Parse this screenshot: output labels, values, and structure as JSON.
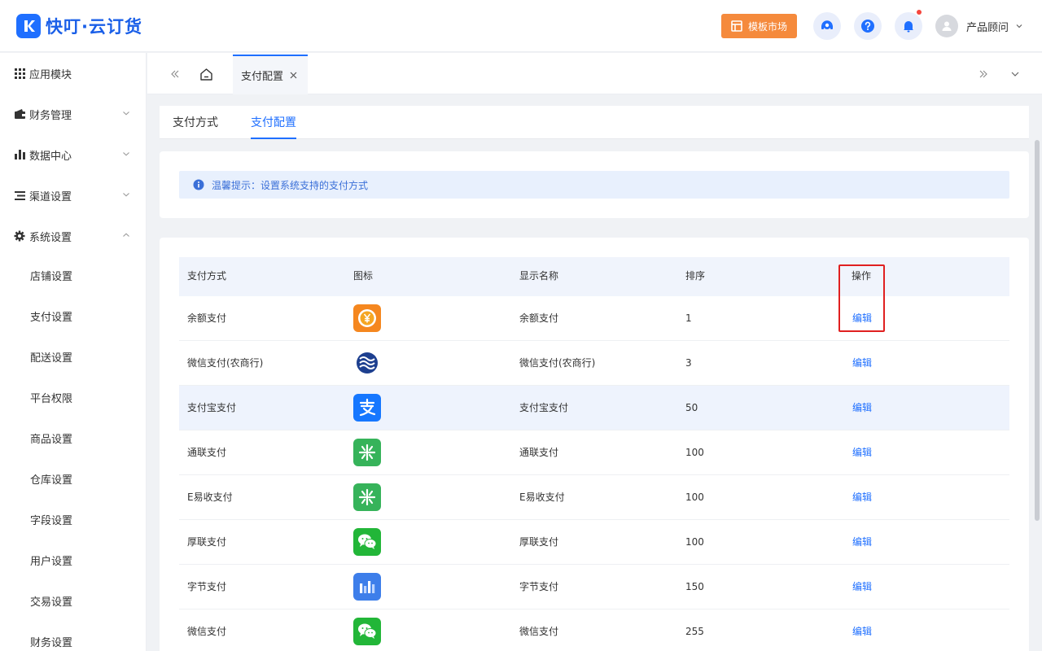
{
  "header": {
    "logo_text": "快叮·云订货",
    "template_market": "模板市场",
    "user_name": "产品顾问"
  },
  "sidebar": {
    "groups": [
      {
        "label": "应用模块",
        "icon": "grid-icon",
        "expanded": null
      },
      {
        "label": "财务管理",
        "icon": "wallet-icon",
        "expanded": false
      },
      {
        "label": "数据中心",
        "icon": "bar-chart-icon",
        "expanded": false
      },
      {
        "label": "渠道设置",
        "icon": "list-icon",
        "expanded": false
      },
      {
        "label": "系统设置",
        "icon": "gear-icon",
        "expanded": true
      }
    ],
    "sub_items": [
      "店铺设置",
      "支付设置",
      "配送设置",
      "平台权限",
      "商品设置",
      "仓库设置",
      "字段设置",
      "用户设置",
      "交易设置",
      "财务设置"
    ]
  },
  "tabbar": {
    "active_tab": "支付配置"
  },
  "subtabs": [
    "支付方式",
    "支付配置"
  ],
  "tip": {
    "text": "温馨提示：设置系统支持的支付方式"
  },
  "table": {
    "headers": [
      "支付方式",
      "图标",
      "显示名称",
      "排序",
      "操作"
    ],
    "rows": [
      {
        "method": "余额支付",
        "icon": "balance-yuan-icon",
        "display_name": "余额支付",
        "sort": "1",
        "action": "编辑"
      },
      {
        "method": "微信支付(农商行)",
        "icon": "rural-bank-wave-icon",
        "display_name": "微信支付(农商行)",
        "sort": "3",
        "action": "编辑"
      },
      {
        "method": "支付宝支付",
        "icon": "alipay-icon",
        "display_name": "支付宝支付",
        "sort": "50",
        "action": "编辑"
      },
      {
        "method": "通联支付",
        "icon": "allinpay-icon",
        "display_name": "通联支付",
        "sort": "100",
        "action": "编辑"
      },
      {
        "method": "E易收支付",
        "icon": "allinpay-icon",
        "display_name": "E易收支付",
        "sort": "100",
        "action": "编辑"
      },
      {
        "method": "厚联支付",
        "icon": "wechat-icon",
        "display_name": "厚联支付",
        "sort": "100",
        "action": "编辑"
      },
      {
        "method": "字节支付",
        "icon": "bytedance-icon",
        "display_name": "字节支付",
        "sort": "150",
        "action": "编辑"
      },
      {
        "method": "微信支付",
        "icon": "wechat-icon",
        "display_name": "微信支付",
        "sort": "255",
        "action": "编辑"
      }
    ]
  },
  "colors": {
    "primary": "#1f6fff",
    "orange": "#f58a3c",
    "highlight_box": "#e02020"
  }
}
